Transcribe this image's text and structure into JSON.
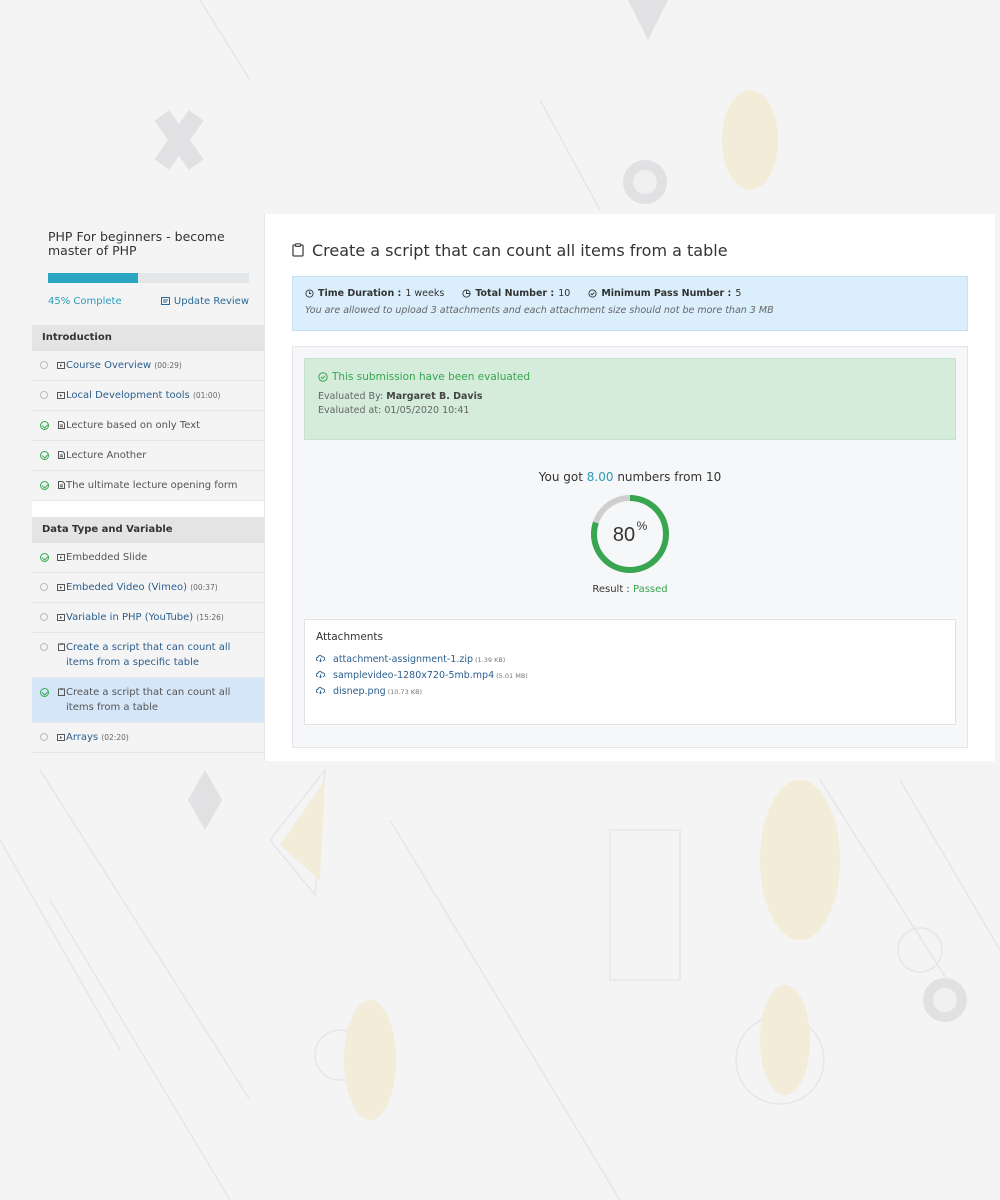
{
  "sidebar": {
    "course_title": "PHP For beginners - become master of PHP",
    "progress": 0.45,
    "progress_label": "45% Complete",
    "update_review_label": "Update Review",
    "sections": [
      {
        "title": "Introduction",
        "lessons": [
          {
            "status": "incomplete",
            "type": "video",
            "label": "Course Overview",
            "duration": "(00:29)",
            "link": true,
            "active": false
          },
          {
            "status": "incomplete",
            "type": "video",
            "label": "Local Development tools",
            "duration": "(01:00)",
            "link": true,
            "active": false
          },
          {
            "status": "complete",
            "type": "document",
            "label": "Lecture based on only Text",
            "duration": "",
            "link": false,
            "active": false
          },
          {
            "status": "complete",
            "type": "document",
            "label": "Lecture Another",
            "duration": "",
            "link": false,
            "active": false
          },
          {
            "status": "complete",
            "type": "document",
            "label": "The ultimate lecture opening form",
            "duration": "",
            "link": false,
            "active": false
          }
        ]
      },
      {
        "title": "Data Type and Variable",
        "lessons": [
          {
            "status": "complete",
            "type": "video",
            "label": "Embedded Slide",
            "duration": "",
            "link": false,
            "active": false
          },
          {
            "status": "incomplete",
            "type": "video",
            "label": "Embeded Video (Vimeo)",
            "duration": "(00:37)",
            "link": true,
            "active": false
          },
          {
            "status": "incomplete",
            "type": "video",
            "label": "Variable in PHP (YouTube)",
            "duration": "(15:26)",
            "link": true,
            "active": false
          },
          {
            "status": "incomplete",
            "type": "assignment",
            "label": "Create a script that can count all items from a specific table",
            "duration": "",
            "link": true,
            "active": false
          },
          {
            "status": "complete",
            "type": "assignment",
            "label": "Create a script that can count all items from a table",
            "duration": "",
            "link": false,
            "active": true
          },
          {
            "status": "incomplete",
            "type": "video",
            "label": "Arrays",
            "duration": "(02:20)",
            "link": true,
            "active": false
          }
        ]
      }
    ]
  },
  "main": {
    "title": "Create a script that can count all items from a table",
    "info": {
      "time_duration_label": "Time Duration :",
      "time_duration_value": "1 weeks",
      "total_number_label": "Total Number :",
      "total_number_value": "10",
      "min_pass_label": "Minimum Pass Number :",
      "min_pass_value": "5",
      "note": "You are allowed to upload 3 attachments and each attachment size should not be more than 3 MB"
    },
    "evaluation": {
      "title": "This submission have been evaluated",
      "evaluated_by_label": "Evaluated By:",
      "evaluated_by_value": "Margaret B. Davis",
      "evaluated_at": "Evaluated at: 01/05/2020 10:41"
    },
    "score": {
      "prefix": "You got",
      "value": "8.00",
      "suffix": "numbers from 10",
      "percent": 80,
      "percent_text": "80",
      "percent_sign": "%",
      "result_label": "Result :",
      "result_value": "Passed"
    },
    "attachments": {
      "title": "Attachments",
      "files": [
        {
          "name": "attachment-assignment-1.zip",
          "size": "(1.39 KB)"
        },
        {
          "name": "samplevideo-1280x720-5mb.mp4",
          "size": "(5.01 MB)"
        },
        {
          "name": "disnep.png",
          "size": "(10.73 KB)"
        }
      ]
    }
  },
  "colors": {
    "accent": "#2ba5c2",
    "success": "#38a551",
    "link": "#2a5e8e",
    "info_bg": "#dbeefc",
    "success_bg": "#d4ecd9",
    "gauge_track": "#cfcfcf"
  }
}
